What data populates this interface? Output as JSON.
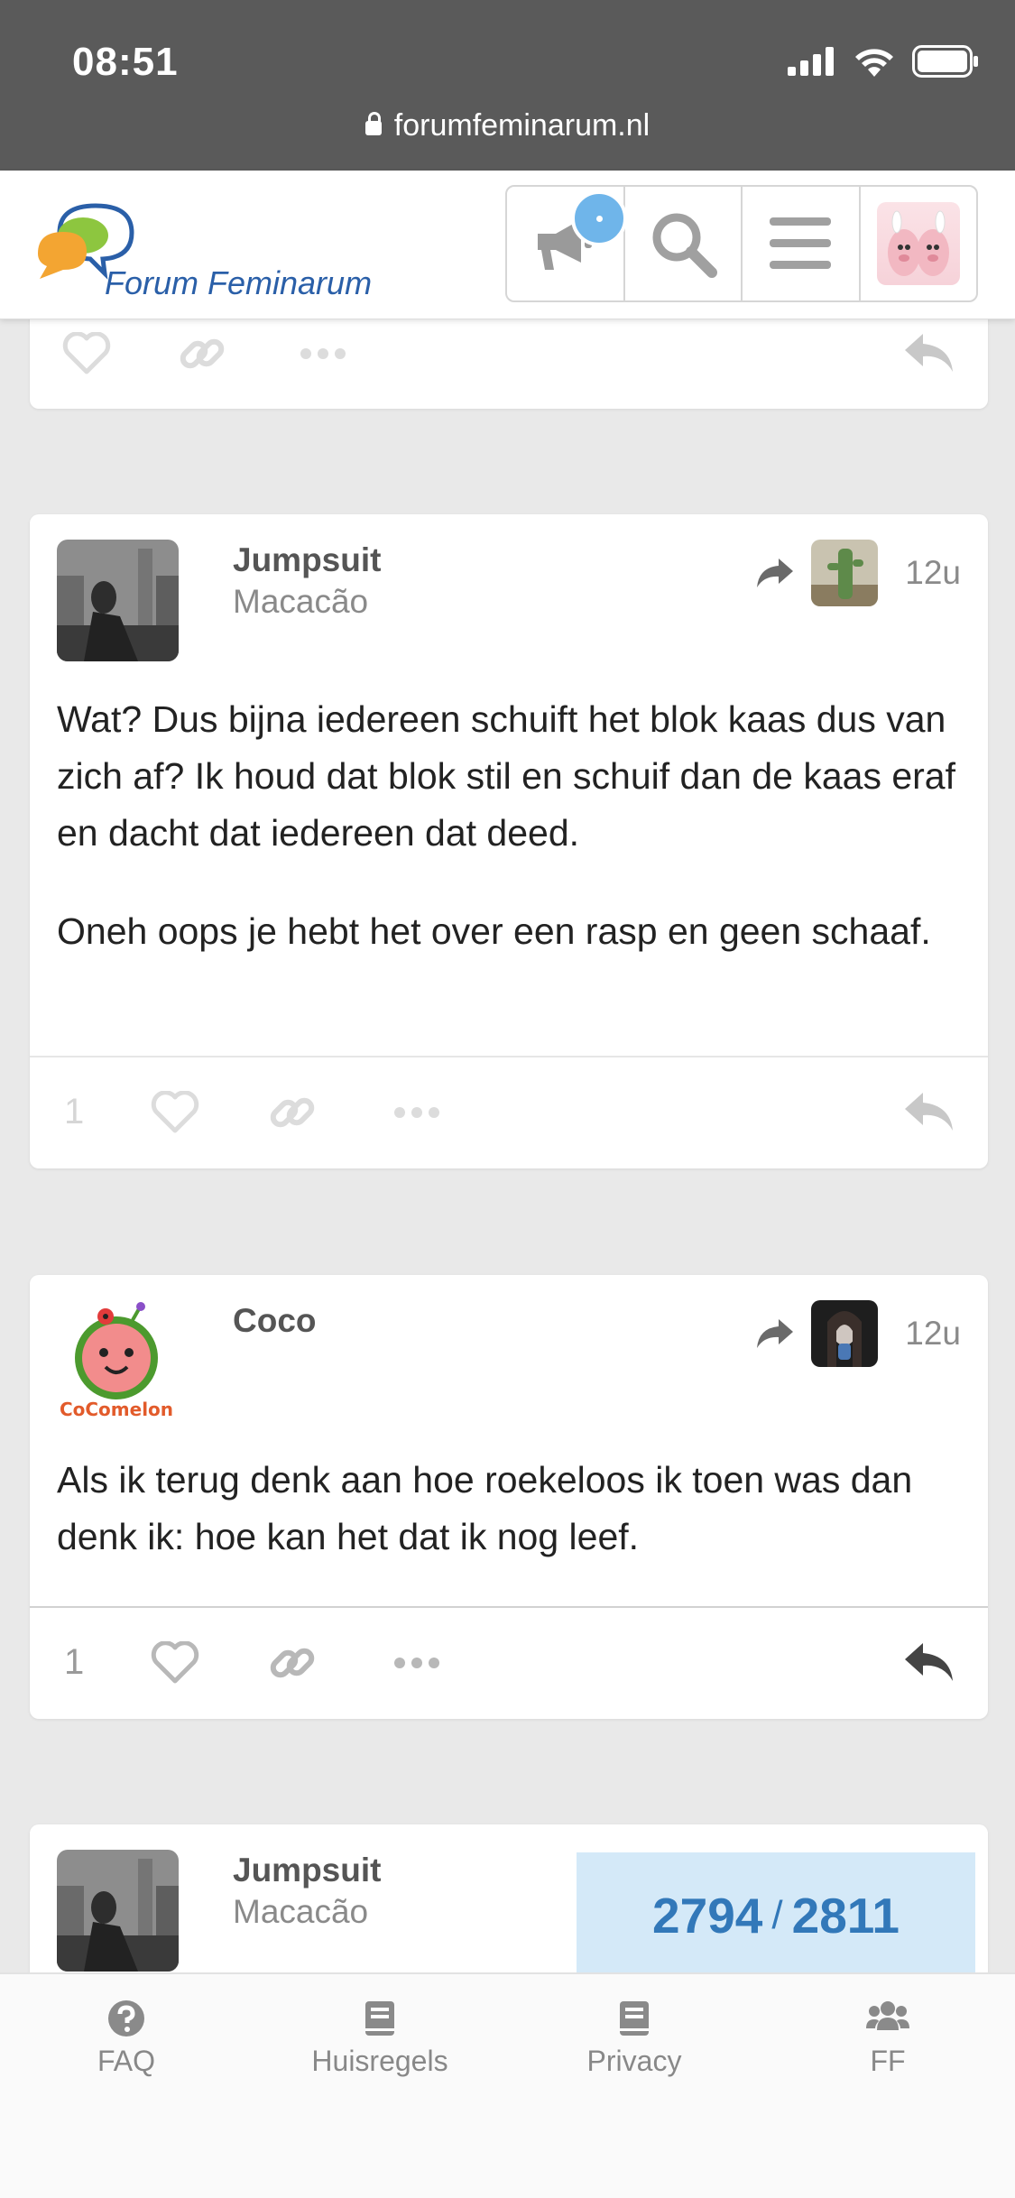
{
  "status_bar": {
    "time": "08:51",
    "url": "forumfeminarum.nl"
  },
  "header": {
    "logo_text": "Forum Feminarum",
    "buttons": [
      "notifications-icon",
      "search-icon",
      "menu-icon",
      "user-avatar"
    ]
  },
  "posts": [
    {
      "author": "Jumpsuit",
      "subtitle": "Macacão",
      "age": "12u",
      "paragraphs": [
        "Wat? Dus bijna iedereen schuift het blok kaas dus van zich af? Ik houd dat blok stil en schuif dan de kaas eraf en dacht dat iedereen dat deed.",
        "Oneh oops je hebt het over een rasp en geen schaaf."
      ],
      "likes": "1"
    },
    {
      "author": "Coco",
      "age": "12u",
      "paragraphs": [
        "Als ik terug denk aan hoe roekeloos ik toen was dan denk ik: hoe kan het dat ik nog leef."
      ],
      "likes": "1"
    },
    {
      "author": "Jumpsuit",
      "subtitle": "Macacão"
    }
  ],
  "progress": {
    "current": "2794",
    "total": "2811"
  },
  "bottom_nav": [
    {
      "label": "FAQ",
      "icon": "question-icon"
    },
    {
      "label": "Huisregels",
      "icon": "book-icon"
    },
    {
      "label": "Privacy",
      "icon": "book-icon"
    },
    {
      "label": "FF",
      "icon": "users-icon"
    }
  ],
  "colors": {
    "accent": "#3278b9",
    "notification": "#6fb5ea",
    "status_bar": "#5a5a5a"
  }
}
